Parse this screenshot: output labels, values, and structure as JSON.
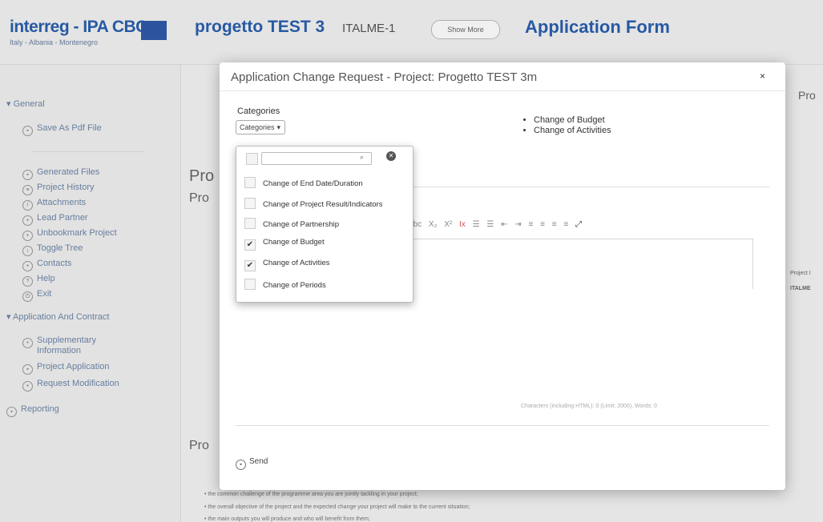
{
  "header": {
    "logo_name": "interreg - IPA CBC",
    "logo_sub": "Italy - Albania - Montenegro",
    "project_title": "progetto TEST 3",
    "project_code": "ITALME-1",
    "show_more": "Show More",
    "app_form": "Application Form"
  },
  "sidebar": {
    "general": "General",
    "save_pdf": "Save As Pdf File",
    "generated_files": "Generated Files",
    "project_history": "Project History",
    "attachments": "Attachments",
    "lead_partner": "Lead Partner",
    "unbookmark": "Unbookmark Project",
    "toggle_tree": "Toggle Tree",
    "contacts": "Contacts",
    "help": "Help",
    "exit": "Exit",
    "app_contract": "Application And Contract",
    "supplementary": "Supplementary",
    "supplementary2": "Information",
    "project_application": "Project Application",
    "request_modification": "Request Modification",
    "reporting": "Reporting"
  },
  "background": {
    "pro_heading1": "Pro",
    "pro_heading2": "Pro",
    "pro_heading3": "Pro",
    "right_pro": "Pro",
    "project_label": "Project I",
    "project_value": "ITALME",
    "bullet1": "the common challenge of the programme area you are jointly tackling in your project;",
    "bullet2": "the overall objective of the project and the expected change your project will make to the current situation;",
    "bullet3": "the main outputs you will produce and who will benefit from them;"
  },
  "modal": {
    "title": "Application Change Request - Project: Progetto TEST 3m",
    "close": "×",
    "categories_label": "Categories",
    "categories_button": "Categories",
    "selected": [
      "Change of Budget",
      "Change of Activities"
    ],
    "char_count": "Characters (including HTML): 0 (Limit: 2000), Words: 0",
    "send": "Send"
  },
  "dropdown": {
    "search_placeholder": "",
    "items": [
      {
        "label": "Change of End Date/Duration",
        "checked": false
      },
      {
        "label": "Change of Project Result/Indicators",
        "checked": false
      },
      {
        "label": "Change of Partnership",
        "checked": false
      },
      {
        "label": "Change of Budget",
        "checked": true
      },
      {
        "label": "Change of Activities",
        "checked": true
      },
      {
        "label": "Change of Periods",
        "checked": false
      }
    ]
  },
  "toolbar": {
    "items": [
      "abc",
      "X₂",
      "X²",
      "Ix",
      "☰",
      "☰",
      "⇤",
      "⇥",
      "≡",
      "≡",
      "≡",
      "≡",
      "⤢"
    ]
  },
  "colors": {
    "brand": "#2a5fae",
    "sidebar_text": "#6e86aa"
  }
}
